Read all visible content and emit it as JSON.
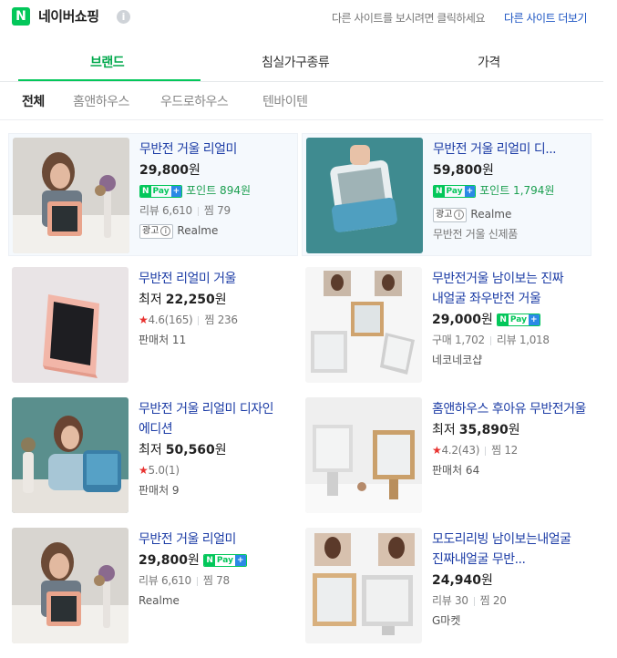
{
  "header": {
    "logo_letter": "N",
    "brand": "네이버쇼핑",
    "info_icon": "i",
    "hint": "다른 사이트를 보시려면 클릭하세요",
    "more_link": "다른 사이트 더보기"
  },
  "tabs": [
    "브랜드",
    "침실가구종류",
    "가격"
  ],
  "subtabs": [
    "전체",
    "홈앤하우스",
    "우드로하우스",
    "텐바이텐"
  ],
  "npay": {
    "n": "N",
    "pay": "Pay",
    "plus": "+"
  },
  "ad_label": "광고",
  "ad_info": "i",
  "products": [
    {
      "title": "무반전 거울 리얼미",
      "price": "29,800",
      "unit": "원",
      "points": "포인트 894원",
      "stats": [
        "리뷰 6,610",
        "찜 79"
      ],
      "seller": "Realme",
      "ad": true
    },
    {
      "title": "무반전 거울 리얼미 디...",
      "price": "59,800",
      "unit": "원",
      "points": "포인트 1,794원",
      "seller": "Realme",
      "seller2": "무반전 거울 신제품",
      "ad": true
    },
    {
      "title": "무반전 리얼미 거울",
      "prefix": "최저",
      "price": "22,250",
      "unit": "원",
      "rating": "4.6",
      "rating_count": "(165)",
      "stats": [
        "찜 236"
      ],
      "seller": "판매처 11"
    },
    {
      "title": "무반전거울 남이보는 진짜 내얼굴 좌우반전 거울",
      "price": "29,000",
      "unit": "원",
      "stats": [
        "구매 1,702",
        "리뷰 1,018"
      ],
      "seller": "네코네코샵"
    },
    {
      "title": "무반전 거울 리얼미 디자인 에디션",
      "prefix": "최저",
      "price": "50,560",
      "unit": "원",
      "rating": "5.0",
      "rating_count": "(1)",
      "seller": "판매처 9"
    },
    {
      "title": "홈앤하우스 후아유 무반전거울",
      "prefix": "최저",
      "price": "35,890",
      "unit": "원",
      "rating": "4.2",
      "rating_count": "(43)",
      "stats": [
        "찜 12"
      ],
      "seller": "판매처 64"
    },
    {
      "title": "무반전 거울 리얼미",
      "price": "29,800",
      "unit": "원",
      "stats": [
        "리뷰 6,610",
        "찜 78"
      ],
      "seller": "Realme"
    },
    {
      "title": "모도리리빙 남이보는내얼굴 진짜내얼굴 무반...",
      "price": "24,940",
      "unit": "원",
      "stats": [
        "리뷰 30",
        "찜 20"
      ],
      "seller": "G마켓"
    }
  ],
  "colors": {
    "accent_green": "#03c75a",
    "link_blue": "#1d3da6",
    "star_red": "#e8322f",
    "npay_plus_blue": "#2b89e6"
  }
}
